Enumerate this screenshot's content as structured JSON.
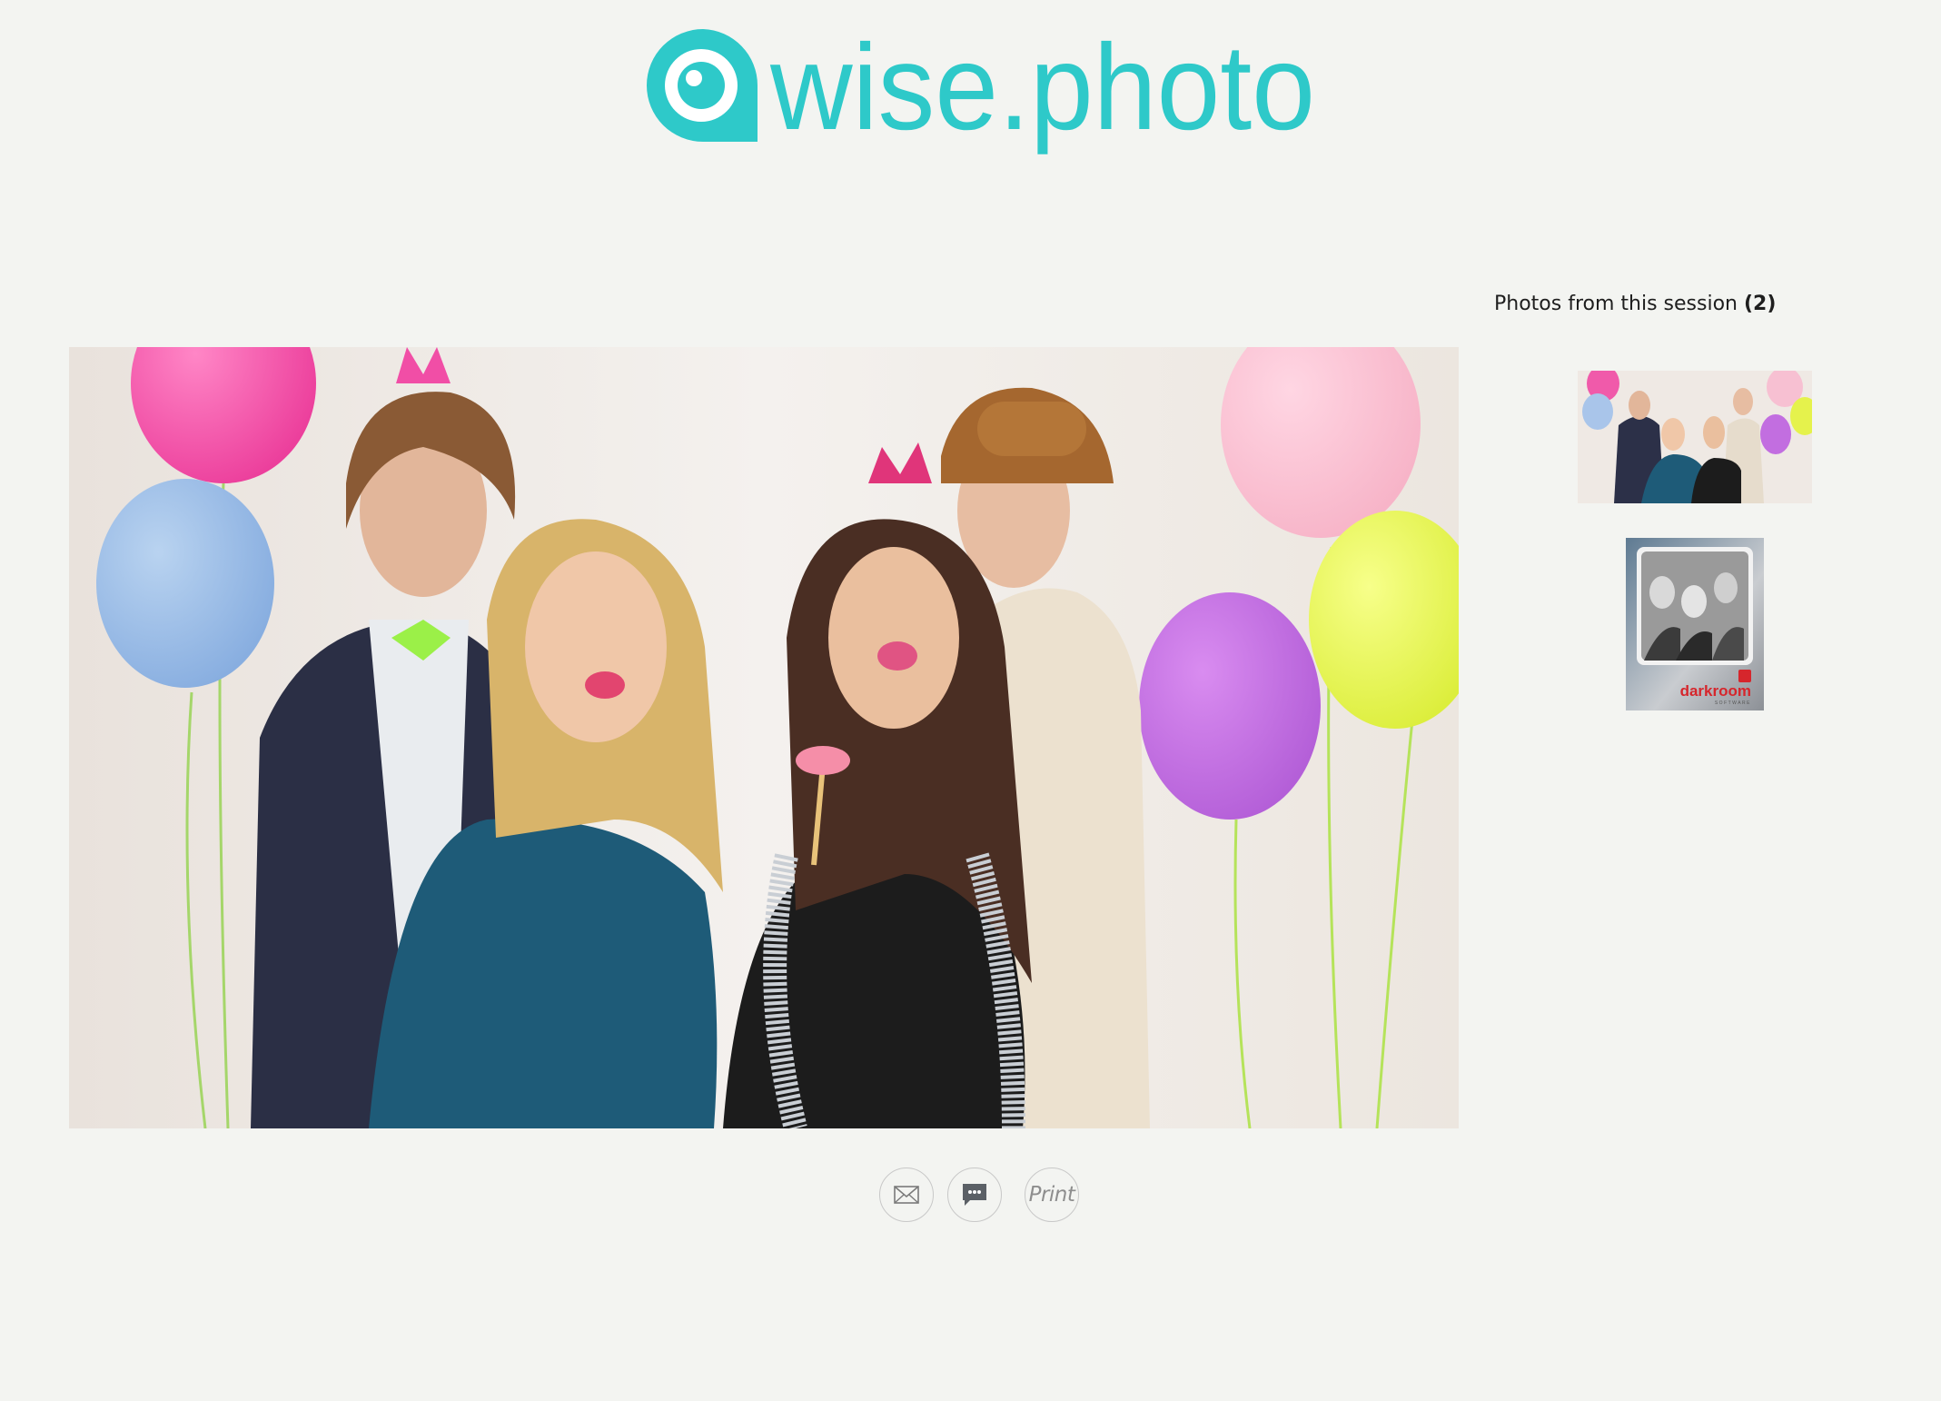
{
  "brand": {
    "logo_text": "wise.photo",
    "logo_color": "#2ec9c9"
  },
  "main_photo": {
    "alt": "Photo booth picture of four friends posing with balloons and props"
  },
  "session": {
    "title": "Photos from this session",
    "count": "(2)",
    "thumbnails": [
      {
        "label": "Thumbnail: group photo with balloons"
      },
      {
        "label": "Thumbnail: darkroom software print layout",
        "brand_text": "darkroom",
        "brand_sub": "SOFTWARE"
      }
    ]
  },
  "actions": {
    "email_icon": "envelope-icon",
    "sms_icon": "chat-bubble-icon",
    "print_label": "Print"
  }
}
